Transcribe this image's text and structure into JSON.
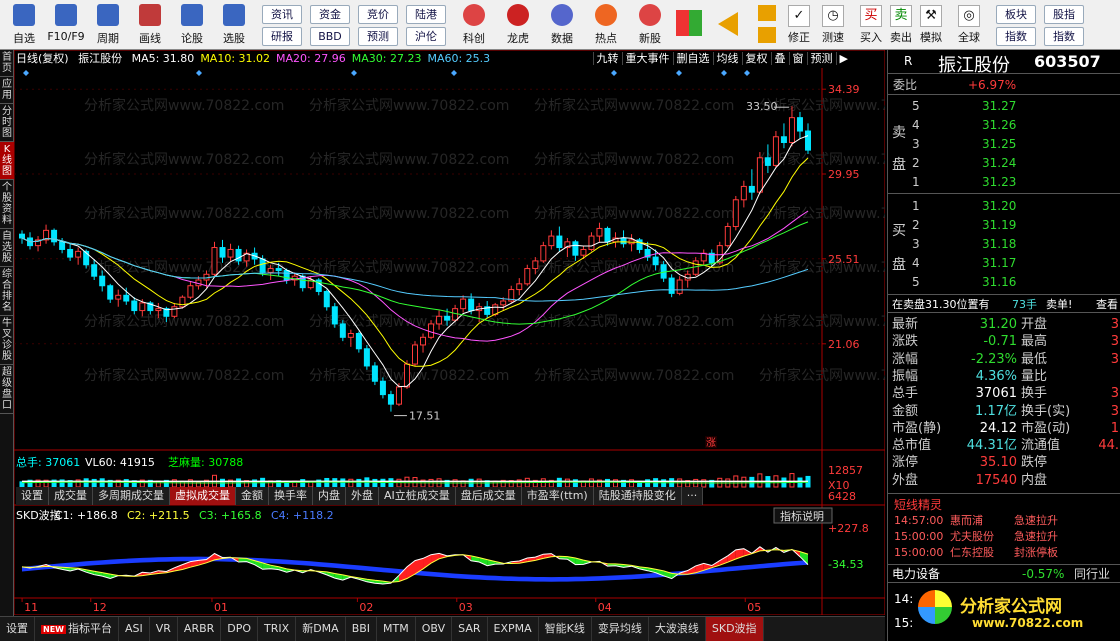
{
  "toolbar": {
    "items": [
      {
        "label": "自选",
        "icon": "grid-icon"
      },
      {
        "label": "F10/F9",
        "icon": "document-icon"
      },
      {
        "label": "周期",
        "icon": "clock-icon"
      },
      {
        "label": "画线",
        "icon": "pencil-icon"
      },
      {
        "label": "论股",
        "icon": "lun-icon"
      },
      {
        "label": "选股",
        "icon": "select-icon"
      }
    ],
    "buttons_top": [
      "资讯",
      "资金",
      "竞价",
      "陆港"
    ],
    "buttons_bottom": [
      "研报",
      "BBD",
      "预测",
      "沪伦"
    ],
    "items2": [
      {
        "label": "科创",
        "icon": "chart-icon"
      },
      {
        "label": "龙虎",
        "icon": "tiger-icon"
      },
      {
        "label": "数据",
        "icon": "pe-icon"
      },
      {
        "label": "热点",
        "icon": "fire-icon"
      },
      {
        "label": "新股",
        "icon": "new-stock-icon"
      }
    ],
    "right_items": [
      {
        "label": "修正",
        "glyph": "✓"
      },
      {
        "label": "测速",
        "glyph": "◷"
      },
      {
        "label": "买入",
        "glyph": "买"
      },
      {
        "label": "卖出",
        "glyph": "卖"
      },
      {
        "label": "模拟",
        "glyph": "⚒"
      },
      {
        "label": "全球",
        "glyph": "◎"
      }
    ],
    "buttons_right_top": [
      "板块",
      "股指"
    ],
    "buttons_right_bottom": [
      "指数",
      "指数"
    ]
  },
  "left_tabs": [
    "首页",
    "应用",
    "分时图",
    "K线图",
    "个股资料",
    "自选股",
    "综合排名",
    "牛叉诊股",
    "超级盘口"
  ],
  "main_header": {
    "period": "日线(复权)",
    "stock": "振江股份",
    "ma": [
      {
        "label": "MA5: 31.80",
        "color": "#ffffff"
      },
      {
        "label": "MA10: 31.02",
        "color": "#ffff00"
      },
      {
        "label": "MA20: 27.96",
        "color": "#ff55ff"
      },
      {
        "label": "MA30: 27.23",
        "color": "#33ff33"
      },
      {
        "label": "MA60: 25.3",
        "color": "#55ccff"
      }
    ],
    "menu": [
      "九转",
      "重大事件",
      "删自选",
      "均线",
      "复权",
      "叠",
      "窗",
      "预测",
      "▶"
    ]
  },
  "price_axis": [
    "34.39",
    "29.95",
    "25.51",
    "21.06"
  ],
  "high_label": "33.50",
  "low_label": "17.51",
  "zhang_label": "涨",
  "volume": {
    "header": [
      {
        "label": "总手: 37061",
        "color": "#00ffff"
      },
      {
        "label": "VL60: 41915",
        "color": "#ffffff"
      },
      {
        "label": "芝麻量: 30788",
        "color": "#00ff00"
      }
    ],
    "axis": [
      "12857",
      "6428",
      "X10"
    ]
  },
  "volume_tabs": [
    "设置",
    "成交量",
    "多周期成交量",
    "虚拟成交量",
    "金额",
    "换手率",
    "内盘",
    "外盘",
    "AI立桩成交量",
    "盘后成交量",
    "市盈率(ttm)",
    "陆股通持股变化",
    "···"
  ],
  "skd": {
    "title": "SKD波指",
    "c1": "C1: +186.8",
    "c2": "C2: +211.5",
    "c3": "C3: +165.8",
    "c4": "C4: +118.2",
    "btn": "指标说明",
    "axis": [
      "+227.8",
      "-34.53"
    ]
  },
  "date_axis": [
    "11",
    "12",
    "01",
    "02",
    "03",
    "04",
    "05"
  ],
  "bottom_tabs": [
    "设置",
    "指标平台",
    "ASI",
    "VR",
    "ARBR",
    "DPO",
    "TRIX",
    "新DMA",
    "BBI",
    "MTM",
    "OBV",
    "SAR",
    "EXPMA",
    "智能K线",
    "变异均线",
    "大波浪线",
    "SKD波指"
  ],
  "new_badge": "NEW",
  "right_panel": {
    "letter": "R",
    "name": "振江股份",
    "code": "603507",
    "weibi_label": "委比",
    "weibi": "+6.97%",
    "sell_label": [
      "卖",
      "盘"
    ],
    "buy_label": [
      "买",
      "盘"
    ],
    "asks": [
      {
        "lvl": "5",
        "price": "31.27"
      },
      {
        "lvl": "4",
        "price": "31.26"
      },
      {
        "lvl": "3",
        "price": "31.25"
      },
      {
        "lvl": "2",
        "price": "31.24"
      },
      {
        "lvl": "1",
        "price": "31.23"
      }
    ],
    "bids": [
      {
        "lvl": "1",
        "price": "31.20"
      },
      {
        "lvl": "2",
        "price": "31.19"
      },
      {
        "lvl": "3",
        "price": "31.18"
      },
      {
        "lvl": "4",
        "price": "31.17"
      },
      {
        "lvl": "5",
        "price": "31.16"
      }
    ],
    "position_text": "在卖盘31.30位置有",
    "position_qty": "73手",
    "sell_single": "卖单!",
    "view": "查看",
    "quote": [
      {
        "k1": "最新",
        "v1": "31.20",
        "c1": "grn",
        "k2": "开盘",
        "v2": "3"
      },
      {
        "k1": "涨跌",
        "v1": "-0.71",
        "c1": "grn",
        "k2": "最高",
        "v2": "3"
      },
      {
        "k1": "涨幅",
        "v1": "-2.23%",
        "c1": "grn",
        "k2": "最低",
        "v2": "3"
      },
      {
        "k1": "振幅",
        "v1": "4.36%",
        "c1": "cy",
        "k2": "量比",
        "v2": ""
      },
      {
        "k1": "总手",
        "v1": "37061",
        "c1": "wht",
        "k2": "换手",
        "v2": "3"
      },
      {
        "k1": "金额",
        "v1": "1.17亿",
        "c1": "cy",
        "k2": "换手(实)",
        "v2": "3"
      },
      {
        "k1": "市盈(静)",
        "v1": "24.12",
        "c1": "wht",
        "k2": "市盈(动)",
        "v2": "1"
      },
      {
        "k1": "总市值",
        "v1": "44.31亿",
        "c1": "cy",
        "k2": "流通值",
        "v2": "44."
      },
      {
        "k1": "涨停",
        "v1": "35.10",
        "c1": "red",
        "k2": "跌停",
        "v2": ""
      },
      {
        "k1": "外盘",
        "v1": "17540",
        "c1": "red",
        "k2": "内盘",
        "v2": ""
      }
    ],
    "elf_title": "短线精灵",
    "elf": [
      {
        "t": "14:57:00",
        "n": "惠而浦",
        "e": "急速拉升"
      },
      {
        "t": "15:00:00",
        "n": "尤夫股份",
        "e": "急速拉升"
      },
      {
        "t": "15:00:00",
        "n": "仁东控股",
        "e": "封涨停板"
      }
    ],
    "sector": {
      "name": "电力设备",
      "chg": "-0.57%",
      "tab": "同行业"
    },
    "footer_time": "14:",
    "footer_time2": "15:",
    "logo_text": "分析家公式网",
    "logo_url": "www.70822.com"
  },
  "watermark": "分析家公式网www.70822.com",
  "colors": {
    "up": "#ff3b3b",
    "down": "#00e5ff",
    "accent": "#a01010"
  },
  "chart_data": {
    "type": "candlestick",
    "title": "振江股份 日线(复权)",
    "x_range": [
      "11",
      "05"
    ],
    "ylim": [
      15.5,
      35.5
    ],
    "high": 33.5,
    "low": 17.51,
    "ohlc": [
      [
        26.8,
        27.0,
        26.3,
        26.6
      ],
      [
        26.6,
        26.9,
        26.0,
        26.2
      ],
      [
        26.2,
        26.7,
        25.9,
        26.5
      ],
      [
        26.5,
        27.3,
        26.3,
        27.0
      ],
      [
        27.0,
        27.1,
        26.2,
        26.4
      ],
      [
        26.4,
        26.6,
        25.8,
        26.0
      ],
      [
        26.0,
        26.3,
        25.4,
        25.6
      ],
      [
        25.6,
        26.1,
        25.2,
        25.9
      ],
      [
        25.9,
        26.0,
        25.0,
        25.2
      ],
      [
        25.2,
        25.5,
        24.4,
        24.6
      ],
      [
        24.6,
        24.9,
        23.8,
        24.1
      ],
      [
        24.1,
        24.2,
        23.2,
        23.4
      ],
      [
        23.4,
        23.9,
        23.0,
        23.6
      ],
      [
        23.6,
        24.0,
        23.1,
        23.3
      ],
      [
        23.3,
        23.5,
        22.6,
        22.8
      ],
      [
        22.8,
        23.4,
        22.5,
        23.2
      ],
      [
        23.2,
        23.3,
        22.6,
        22.8
      ],
      [
        22.8,
        23.2,
        22.4,
        22.9
      ],
      [
        22.9,
        23.0,
        22.2,
        22.5
      ],
      [
        22.5,
        23.2,
        22.4,
        23.0
      ],
      [
        23.0,
        23.6,
        22.9,
        23.5
      ],
      [
        23.5,
        24.3,
        23.4,
        24.1
      ],
      [
        24.1,
        24.6,
        23.9,
        24.4
      ],
      [
        24.4,
        24.9,
        24.0,
        24.7
      ],
      [
        24.7,
        26.4,
        24.6,
        26.1
      ],
      [
        26.1,
        26.5,
        25.3,
        25.6
      ],
      [
        25.6,
        26.3,
        25.4,
        26.0
      ],
      [
        26.0,
        26.2,
        25.2,
        25.4
      ],
      [
        25.4,
        26.0,
        25.1,
        25.8
      ],
      [
        25.8,
        26.1,
        25.2,
        25.5
      ],
      [
        25.5,
        25.7,
        24.6,
        24.8
      ],
      [
        24.8,
        25.2,
        24.4,
        25.0
      ],
      [
        25.0,
        25.3,
        24.6,
        24.9
      ],
      [
        24.9,
        25.0,
        24.2,
        24.4
      ],
      [
        24.4,
        24.8,
        24.1,
        24.6
      ],
      [
        24.6,
        24.7,
        23.8,
        24.0
      ],
      [
        24.0,
        24.6,
        23.9,
        24.4
      ],
      [
        24.4,
        24.5,
        23.6,
        23.8
      ],
      [
        23.8,
        23.9,
        22.8,
        23.0
      ],
      [
        23.0,
        23.2,
        21.9,
        22.1
      ],
      [
        22.1,
        22.3,
        21.2,
        21.4
      ],
      [
        21.4,
        21.8,
        20.9,
        21.6
      ],
      [
        21.6,
        21.7,
        20.6,
        20.8
      ],
      [
        20.8,
        21.0,
        19.7,
        19.9
      ],
      [
        19.9,
        20.1,
        18.9,
        19.1
      ],
      [
        19.1,
        19.3,
        18.2,
        18.4
      ],
      [
        18.4,
        18.6,
        17.51,
        17.9
      ],
      [
        17.9,
        19.0,
        17.8,
        18.8
      ],
      [
        18.8,
        20.2,
        18.7,
        20.0
      ],
      [
        20.0,
        21.2,
        19.9,
        21.0
      ],
      [
        21.0,
        21.6,
        20.6,
        21.4
      ],
      [
        21.4,
        22.3,
        21.3,
        22.1
      ],
      [
        22.1,
        22.8,
        21.8,
        22.5
      ],
      [
        22.5,
        22.9,
        22.0,
        22.3
      ],
      [
        22.3,
        23.1,
        22.2,
        22.9
      ],
      [
        22.9,
        23.6,
        22.7,
        23.4
      ],
      [
        23.4,
        23.7,
        22.6,
        22.8
      ],
      [
        22.8,
        23.2,
        22.2,
        23.0
      ],
      [
        23.0,
        23.3,
        22.4,
        22.6
      ],
      [
        22.6,
        23.2,
        22.5,
        23.1
      ],
      [
        23.1,
        23.5,
        22.8,
        23.3
      ],
      [
        23.3,
        24.1,
        23.2,
        23.9
      ],
      [
        23.9,
        24.5,
        23.6,
        24.2
      ],
      [
        24.2,
        25.2,
        24.1,
        25.0
      ],
      [
        25.0,
        25.6,
        24.7,
        25.4
      ],
      [
        25.4,
        26.4,
        25.3,
        26.2
      ],
      [
        26.2,
        27.0,
        26.0,
        26.7
      ],
      [
        26.7,
        27.2,
        25.9,
        26.1
      ],
      [
        26.1,
        26.6,
        25.6,
        26.4
      ],
      [
        26.4,
        26.5,
        25.4,
        25.7
      ],
      [
        25.7,
        26.2,
        25.5,
        26.0
      ],
      [
        26.0,
        26.9,
        25.9,
        26.7
      ],
      [
        26.7,
        27.4,
        26.4,
        27.1
      ],
      [
        27.1,
        27.2,
        26.2,
        26.4
      ],
      [
        26.4,
        26.9,
        26.1,
        26.6
      ],
      [
        26.6,
        27.0,
        26.1,
        26.3
      ],
      [
        26.3,
        26.8,
        25.9,
        26.5
      ],
      [
        26.5,
        26.6,
        25.8,
        26.0
      ],
      [
        26.0,
        26.4,
        25.4,
        25.6
      ],
      [
        25.6,
        26.0,
        24.9,
        25.2
      ],
      [
        25.2,
        25.4,
        24.3,
        24.5
      ],
      [
        24.5,
        24.7,
        23.5,
        23.7
      ],
      [
        23.7,
        24.6,
        23.6,
        24.4
      ],
      [
        24.4,
        24.9,
        24.0,
        24.7
      ],
      [
        24.7,
        25.6,
        24.6,
        25.4
      ],
      [
        25.4,
        26.0,
        25.2,
        25.8
      ],
      [
        25.8,
        26.0,
        25.1,
        25.3
      ],
      [
        25.3,
        26.4,
        25.2,
        26.2
      ],
      [
        26.2,
        27.4,
        26.1,
        27.2
      ],
      [
        27.2,
        28.8,
        27.0,
        28.6
      ],
      [
        28.6,
        29.6,
        28.2,
        29.3
      ],
      [
        29.3,
        30.2,
        28.6,
        29.0
      ],
      [
        29.0,
        31.1,
        28.9,
        30.8
      ],
      [
        30.8,
        31.5,
        30.0,
        30.4
      ],
      [
        30.4,
        32.2,
        30.3,
        31.9
      ],
      [
        31.9,
        32.6,
        31.3,
        31.6
      ],
      [
        31.6,
        33.5,
        31.4,
        32.9
      ],
      [
        32.9,
        33.2,
        31.8,
        32.2
      ],
      [
        32.2,
        32.6,
        31.0,
        31.2
      ]
    ],
    "ma_labels": [
      "MA5",
      "MA10",
      "MA20",
      "MA30",
      "MA60"
    ],
    "volume_ylim": [
      0,
      12857
    ],
    "skd_ylim": [
      -34.53,
      227.8
    ]
  }
}
